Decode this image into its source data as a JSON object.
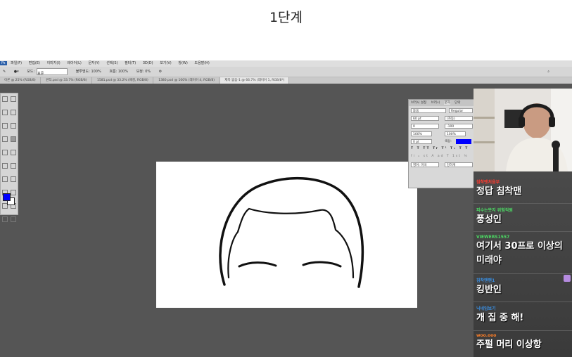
{
  "caption": "1단계",
  "photoshop": {
    "menu": [
      "파일(F)",
      "편집(E)",
      "이미지(I)",
      "레이어(L)",
      "문자(Y)",
      "선택(S)",
      "필터(T)",
      "3D(D)",
      "보기(V)",
      "창(W)",
      "도움말(H)"
    ],
    "options": {
      "mode_label": "모드:",
      "mode_value": "표준",
      "opacity_label": "불투명도:",
      "opacity_value": "100%",
      "flow_label": "흐름:",
      "flow_value": "100%",
      "smoothing_label": "보정:",
      "smoothing_value": "0%"
    },
    "tabs": [
      "이론 @ 25% (RGB/8)",
      "원작.psd @ 33.7% (RGB/8)",
      "1581.psd @ 33.2% (배경, RGB/8)",
      "1380.psd @ 100% (레이어 4, RGB/8)",
      "제목 없음-1 @ 66.7% (레이어 1, RGB/8*)"
    ],
    "active_tab_index": 4,
    "character_panel": {
      "tabs": [
        "브러시 설정",
        "브러시",
        "문자",
        "단락"
      ],
      "font": "돋움",
      "style": "Regular",
      "size": "60 pt",
      "leading": "(자동)",
      "kerning": "0",
      "tracking": "-100",
      "scale_v": "100%",
      "scale_h": "100%",
      "baseline": "0 pt",
      "color_label": "색상:",
      "language": "영어: 미국",
      "antialias": "강하게",
      "text_color": "#0000ff"
    },
    "foreground_color": "#0000ff",
    "background_color": "#ffffff"
  },
  "chat": [
    {
      "name": "침착맨처음부",
      "name_color": "#ff3b30",
      "text": "정답 침착맨"
    },
    {
      "name": "피수는못지 위험직원",
      "name_color": "#4cd964",
      "text": "풍성인"
    },
    {
      "name": "VIEWERS1557",
      "name_color": "#4cd964",
      "text": "여기서 30프로 이상의 미래야"
    },
    {
      "name": "침착맨팬1",
      "name_color": "#3a8dde",
      "text": "킹반인"
    },
    {
      "name": "닉네임보기",
      "name_color": "#3a8dde",
      "text": "개 집 중 해!"
    },
    {
      "name": "woo.ooo",
      "name_color": "#ff7f27",
      "text": "주펄 머리 이상항"
    }
  ]
}
